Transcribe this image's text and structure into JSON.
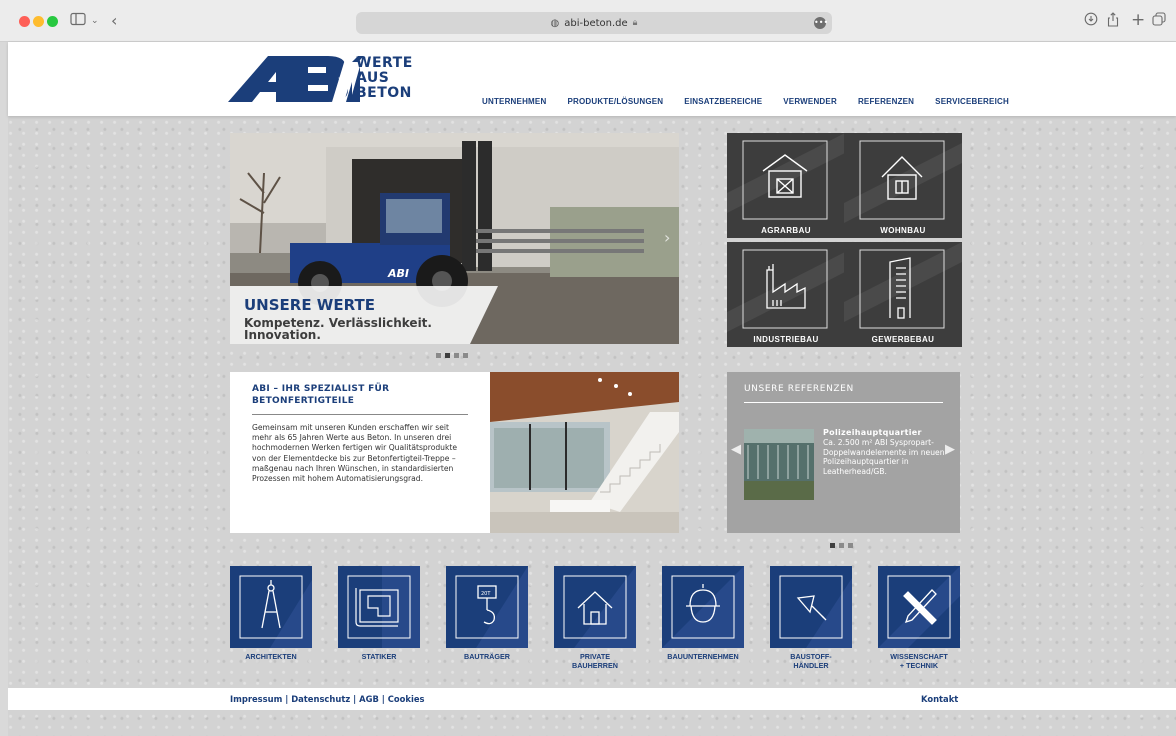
{
  "browser": {
    "url": "abi-beton.de",
    "colors": {
      "close": "#fe5f57",
      "minimize": "#febc2e",
      "maximize": "#28c840"
    }
  },
  "brand": {
    "logo_letters": "ABI",
    "tagline_lines": [
      "WERTE",
      "AUS",
      "BETON"
    ],
    "color": "#1b3e7a"
  },
  "nav": {
    "items": [
      "UNTERNEHMEN",
      "PRODUKTE/LÖSUNGEN",
      "EINSATZBEREICHE",
      "VERWENDER",
      "REFERENZEN",
      "SERVICEBEREICH"
    ]
  },
  "hero": {
    "title": "UNSERE WERTE",
    "subtitle": "Kompetenz. Verlässlichkeit. Innovation.",
    "forklift_badge": "ABI",
    "slides": 4,
    "active_slide": 2
  },
  "categories": [
    {
      "label": "AGRARBAU",
      "icon": "barn-icon"
    },
    {
      "label": "WOHNBAU",
      "icon": "house-icon"
    },
    {
      "label": "INDUSTRIEBAU",
      "icon": "factory-icon"
    },
    {
      "label": "GEWERBEBAU",
      "icon": "office-building-icon"
    }
  ],
  "intro": {
    "title": "ABI – IHR SPEZIALIST FÜR BETONFERTIGTEILE",
    "body": "Gemeinsam mit unseren Kunden erschaffen wir seit mehr als 65 Jahren Werte aus Beton. In unseren drei hochmodernen Werken fertigen wir Qualitätsprodukte von der Elementdecke bis zur Betonfertigteil-Treppe – maßgenau nach Ihren Wünschen, in standardisierten Prozessen mit hohem Automatisierungsgrad."
  },
  "references": {
    "title": "UNSERE REFERENZEN",
    "item_title": "Polizeihauptquartier",
    "item_text": "Ca. 2.500 m² ABI Syspropart-Doppelwandelemente im neuen Polizeihauptquartier in Leatherhead/GB.",
    "slides": 3,
    "active_slide": 1
  },
  "target_groups": [
    {
      "label": "ARCHITEKTEN",
      "icon": "compass-icon"
    },
    {
      "label": "STATIKER",
      "icon": "blueprint-icon"
    },
    {
      "label": "BAUTRÄGER",
      "icon": "crane-hook-icon"
    },
    {
      "label": "PRIVATE\nBAUHERREN",
      "icon": "home-icon"
    },
    {
      "label": "BAUUNTERNEHMEN",
      "icon": "hard-hat-icon"
    },
    {
      "label": "BAUSTOFF-\nHÄNDLER",
      "icon": "trowel-icon"
    },
    {
      "label": "WISSENSCHAFT\n+ TECHNIK",
      "icon": "pencil-ruler-icon"
    }
  ],
  "footer": {
    "links": [
      "Impressum",
      "Datenschutz",
      "AGB",
      "Cookies"
    ],
    "separator": " | ",
    "contact": "Kontakt"
  }
}
